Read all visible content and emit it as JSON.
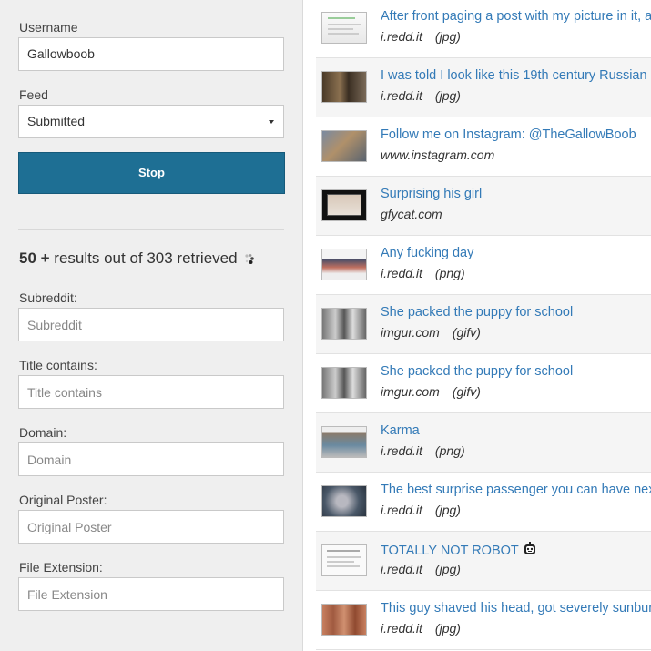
{
  "form": {
    "username_label": "Username",
    "username_value": "Gallowboob",
    "feed_label": "Feed",
    "feed_value": "Submitted",
    "stop_label": "Stop",
    "results_count": "50 +",
    "results_text": "results out of 303 retrieved",
    "subreddit_label": "Subreddit:",
    "subreddit_placeholder": "Subreddit",
    "title_label": "Title contains:",
    "title_placeholder": "Title contains",
    "domain_label": "Domain:",
    "domain_placeholder": "Domain",
    "op_label": "Original Poster:",
    "op_placeholder": "Original Poster",
    "ext_label": "File Extension:",
    "ext_placeholder": "File Extension"
  },
  "posts": [
    {
      "title": "After front paging a post with my picture in it, a",
      "domain": "i.redd.it",
      "ext": "(jpg)"
    },
    {
      "title": "I was told I look like this 19th century Russian",
      "domain": "i.redd.it",
      "ext": "(jpg)"
    },
    {
      "title": "Follow me on Instagram: @TheGallowBoob",
      "domain": "www.instagram.com",
      "ext": ""
    },
    {
      "title": "Surprising his girl",
      "domain": "gfycat.com",
      "ext": ""
    },
    {
      "title": "Any fucking day",
      "domain": "i.redd.it",
      "ext": "(png)"
    },
    {
      "title": "She packed the puppy for school",
      "domain": "imgur.com",
      "ext": "(gifv)"
    },
    {
      "title": "She packed the puppy for school",
      "domain": "imgur.com",
      "ext": "(gifv)"
    },
    {
      "title": "Karma",
      "domain": "i.redd.it",
      "ext": "(png)"
    },
    {
      "title": "The best surprise passenger you can have next",
      "domain": "i.redd.it",
      "ext": "(jpg)"
    },
    {
      "title": "TOTALLY NOT ROBOT",
      "domain": "i.redd.it",
      "ext": "(jpg)"
    },
    {
      "title": "This guy shaved his head, got severely sunburnt",
      "domain": "i.redd.it",
      "ext": "(jpg)"
    }
  ]
}
